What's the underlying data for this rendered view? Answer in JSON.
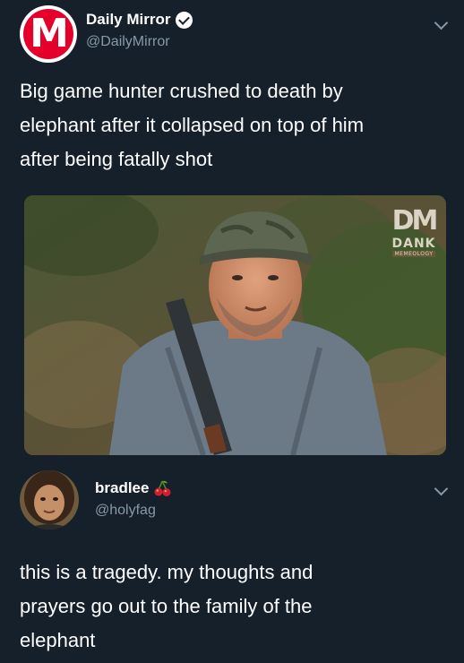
{
  "tweet1": {
    "display_name": "Daily Mirror",
    "handle": "@DailyMirror",
    "avatar_letter": "M",
    "text": "Big game hunter crushed to death by elephant after it collapsed on top of him after being fatally shot",
    "text_lines": [
      "Big game hunter crushed to death by",
      "elephant after it collapsed on top of him",
      "after being fatally shot"
    ],
    "watermark": {
      "logo": "DM",
      "line1": "DANK",
      "line2": "MEMEOLOGY"
    }
  },
  "tweet2": {
    "display_name": "bradlee",
    "handle": "@holyfag",
    "text_lines": [
      "this is a tragedy. my thoughts and",
      "prayers go out to the family of the",
      "elephant"
    ]
  },
  "colors": {
    "background": "#15202b",
    "secondary_text": "#8899a6",
    "mirror_red": "#e4002b"
  },
  "icons": {
    "verified": "verified-badge-icon",
    "chevron": "chevron-down-icon",
    "cherries": "cherries-emoji-icon"
  }
}
